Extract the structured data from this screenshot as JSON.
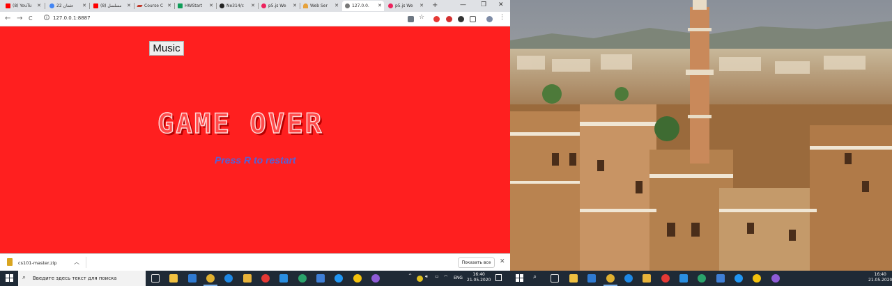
{
  "browser": {
    "tabs": [
      {
        "label": "(8) YouTu",
        "color": "#ff0000"
      },
      {
        "label": "22 عثمان",
        "color": "#4285f4"
      },
      {
        "label": "(8) مسلسل",
        "color": "#ff0000"
      },
      {
        "label": "Course C",
        "color": "#333333"
      },
      {
        "label": "HWStart",
        "color": "#0f9d58"
      },
      {
        "label": "Ne314/c",
        "color": "#222222"
      },
      {
        "label": "p5.js We",
        "color": "#ed225d"
      },
      {
        "label": "Web Ser",
        "color": "#e6a23c"
      },
      {
        "label": "127.0.0.",
        "color": "#777777"
      },
      {
        "label": "p5.js We",
        "color": "#ed225d"
      }
    ],
    "new_tab": "+",
    "window_controls": {
      "minimize": "—",
      "maximize": "❐",
      "close": "✕"
    },
    "nav": {
      "back": "←",
      "forward": "→",
      "reload": "C"
    },
    "url": "127.0.0.1:8887"
  },
  "page": {
    "music_button": "Music",
    "title": "GAME OVER",
    "subtitle": "Press R to restart"
  },
  "downloads": {
    "file": "cs101-master.zip",
    "show_all": "Показать все",
    "close": "✕"
  },
  "taskbar": {
    "search_placeholder": "Введите здесь текст для поиска",
    "language": "ENG",
    "time": "16:40",
    "date": "21.05.2020"
  },
  "colors": {
    "page_bg": "#ff1f1f",
    "title": "#ff4a4a",
    "subtitle": "#5662d6",
    "taskbar": "#1f2a36"
  }
}
